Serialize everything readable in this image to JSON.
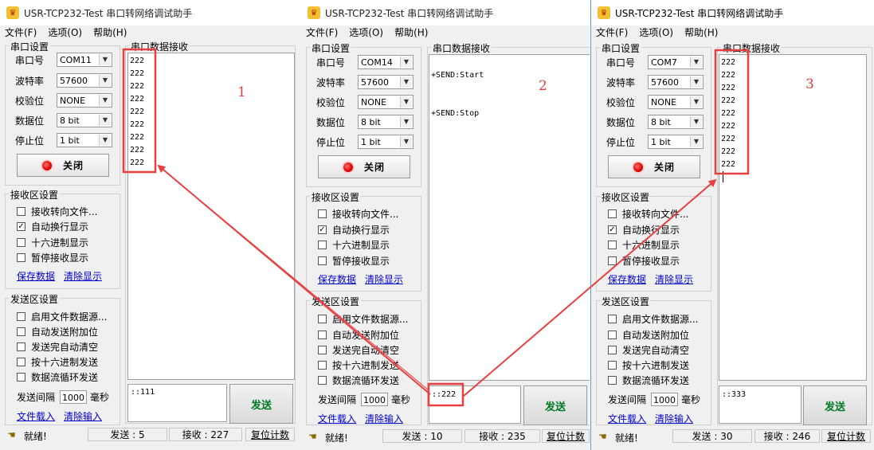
{
  "app_title": "USR-TCP232-Test 串口转网络调试助手",
  "menu": [
    "文件(F)",
    "选项(O)",
    "帮助(H)"
  ],
  "serial_settings": {
    "title": "串口设置",
    "labels": {
      "port": "串口号",
      "baud": "波特率",
      "parity": "校验位",
      "databits": "数据位",
      "stopbits": "停止位"
    },
    "close_button": "关闭"
  },
  "rx_settings": {
    "title": "接收区设置",
    "options": [
      {
        "label": "接收转向文件...",
        "checked": false
      },
      {
        "label": "自动换行显示",
        "checked": true
      },
      {
        "label": "十六进制显示",
        "checked": false
      },
      {
        "label": "暂停接收显示",
        "checked": false
      }
    ],
    "save_link": "保存数据",
    "clear_link": "清除显示"
  },
  "tx_settings": {
    "title": "发送区设置",
    "options": [
      {
        "label": "启用文件数据源...",
        "checked": false
      },
      {
        "label": "自动发送附加位",
        "checked": false
      },
      {
        "label": "发送完自动清空",
        "checked": false
      },
      {
        "label": "按十六进制发送",
        "checked": false
      },
      {
        "label": "数据流循环发送",
        "checked": false
      }
    ],
    "interval_label": "发送间隔",
    "interval_value": "1000",
    "interval_unit": "毫秒",
    "load_link": "文件载入",
    "clear_link": "清除输入"
  },
  "rx_title": "串口数据接收",
  "send_button": "发送",
  "status": {
    "ready": "就绪!",
    "reset": "复位计数"
  },
  "windows": [
    {
      "port": "COM11",
      "baud": "57600",
      "parity": "NONE",
      "databits": "8 bit",
      "stopbits": "1 bit",
      "rx_lines": [
        "222",
        "222",
        "222",
        "222",
        "222",
        "222",
        "222",
        "222",
        "222"
      ],
      "tx_text": "::111",
      "sent": "发送 : 5",
      "received": "接收 : 227",
      "annotation": "1"
    },
    {
      "port": "COM14",
      "baud": "57600",
      "parity": "NONE",
      "databits": "8 bit",
      "stopbits": "1 bit",
      "rx_lines": [
        "+SEND:Start",
        "",
        "",
        "+SEND:Stop"
      ],
      "tx_text": "::222",
      "sent": "发送 : 10",
      "received": "接收 : 235",
      "annotation": "2"
    },
    {
      "port": "COM7",
      "baud": "57600",
      "parity": "NONE",
      "databits": "8 bit",
      "stopbits": "1 bit",
      "rx_lines": [
        "222",
        "222",
        "222",
        "222",
        "222",
        "222",
        "222",
        "222",
        "222"
      ],
      "tx_text": "::333",
      "sent": "发送 : 30",
      "received": "接收 : 246",
      "annotation": "3"
    }
  ],
  "colors": {
    "annotation": "#e84040",
    "send_text": "#007a20",
    "link": "#0000cc"
  }
}
